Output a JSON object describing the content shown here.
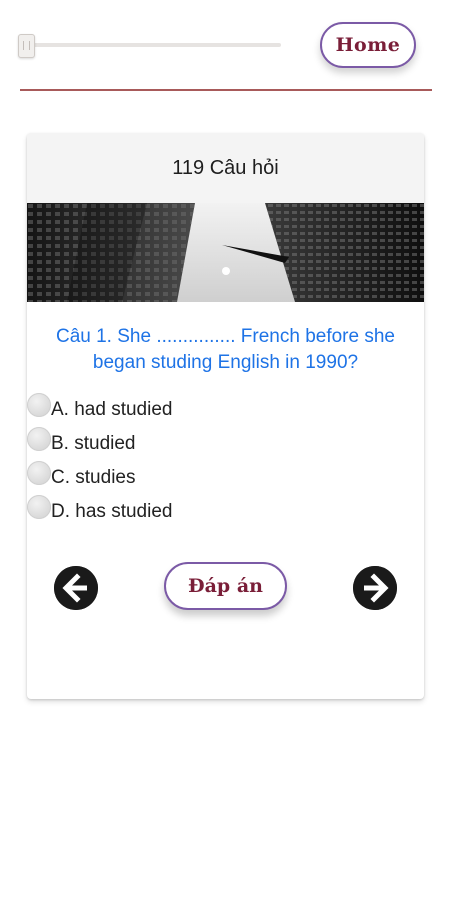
{
  "header": {
    "home_label": "Home",
    "slider_level": 0.0
  },
  "card": {
    "title": "119 Câu hỏi",
    "question": "Câu 1. She ............... French before she began studing English in 1990?",
    "options": [
      {
        "label": "A. had studied"
      },
      {
        "label": "B. studied"
      },
      {
        "label": "C. studies"
      },
      {
        "label": "D. has studied"
      }
    ],
    "answer_label": "Đáp án",
    "prev_icon": "arrow-left-circle-icon",
    "next_icon": "arrow-right-circle-icon"
  },
  "colors": {
    "question_text": "#1e73e6",
    "button_text": "#7a1e38",
    "button_border": "#7b5aa6",
    "divider": "#a85a5a"
  }
}
